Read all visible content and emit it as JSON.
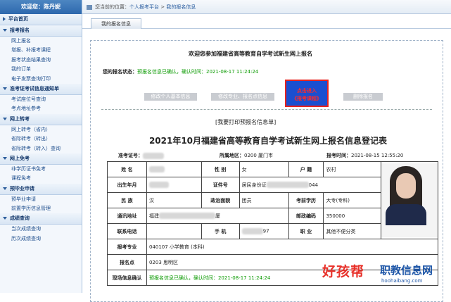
{
  "sidebar": {
    "welcome": "欢迎您：陈丹妮",
    "sections": [
      {
        "title": "平台首页",
        "collapsed": true,
        "items": []
      },
      {
        "title": "报考报名",
        "collapsed": false,
        "items": [
          "网上报名",
          "增报、补报考课程",
          "报考状态结果查询",
          "我的订单",
          "电子发票查询打印"
        ]
      },
      {
        "title": "准考证考试信息通知单",
        "collapsed": false,
        "items": [
          "考试座位号查询",
          "考点地址参考"
        ]
      },
      {
        "title": "网上转考",
        "collapsed": false,
        "items": [
          "网上转考（省内）",
          "省际转考（转出）",
          "省际转考（转入）查询"
        ]
      },
      {
        "title": "网上免考",
        "collapsed": false,
        "items": [
          "非学历证书免考",
          "课程免考"
        ]
      },
      {
        "title": "预毕业申请",
        "collapsed": false,
        "items": [
          "预毕业申请",
          "前置学历信息管理"
        ]
      },
      {
        "title": "成绩查询",
        "collapsed": false,
        "items": [
          "当次成绩查询",
          "历次成绩查询"
        ]
      }
    ]
  },
  "topbar": {
    "prefix": "您当前的位置：",
    "crumb1": "个人报考平台",
    "sep": ">",
    "crumb2": "我的报名信息"
  },
  "tab": "我的报名信息",
  "welcome": "欢迎您参加福建省高等教育自学考试新生网上报名",
  "status": {
    "label": "您的报名状态：",
    "text": "预报名信息已确认，确认时间：2021-08-17 11:24:24"
  },
  "buttons": {
    "b1": "修改个人基本信息",
    "b2": "修改专业、报名点信息",
    "b3_line1": "点击进入",
    "b3_line2": "《报考课程》",
    "b4": "删除报名"
  },
  "print": "[我要打印预报名信息单]",
  "form_title": "2021年10月福建省高等教育自学考试新生网上报名信息登记表",
  "meta": {
    "zkz_label": "准考证号：",
    "zkz": "",
    "area_label": "所属地区：",
    "area": "0200 厦门市",
    "time_label": "报考时间：",
    "time": "2021-08-15 12:55:20"
  },
  "table": {
    "name_l": "姓  名",
    "name": "",
    "gender_l": "性  别",
    "gender": "女",
    "hukou_l": "户  籍",
    "hukou": "农村",
    "birth_l": "出生年月",
    "birth": "",
    "id_l": "证件号",
    "id_type": "居民身份证",
    "id_tail": "044",
    "nation_l": "民  族",
    "nation": "汉",
    "politic_l": "政治面貌",
    "politic": "团员",
    "edu_l": "考前学历",
    "edu": "大专(专科)",
    "addr_l": "通讯地址",
    "addr1": "福建",
    "addr2": "厦",
    "post_l": "邮政编码",
    "post": "350000",
    "phone_l": "联系电话",
    "phone": "",
    "mobile_l": "手  机",
    "mobile_tail": "97",
    "job_l": "职  业",
    "job": "其他不便分类",
    "major_l": "报考专业",
    "major": "040107  小学教育  (本科)",
    "site_l": "报名点",
    "site": "0203  思明区",
    "confirm_l": "现场信息确认",
    "confirm": "预报名信息已确认，确认时间：2021-08-17 11:24:24"
  },
  "watermark": {
    "brand": "好孩帮",
    "site": "职教信息网",
    "url": "hoohaibang.com"
  },
  "colors": {
    "accent": "#2d68ad",
    "green": "#0a9a00",
    "red": "#e8231f",
    "highlight_btn": "#1b4fd0"
  }
}
